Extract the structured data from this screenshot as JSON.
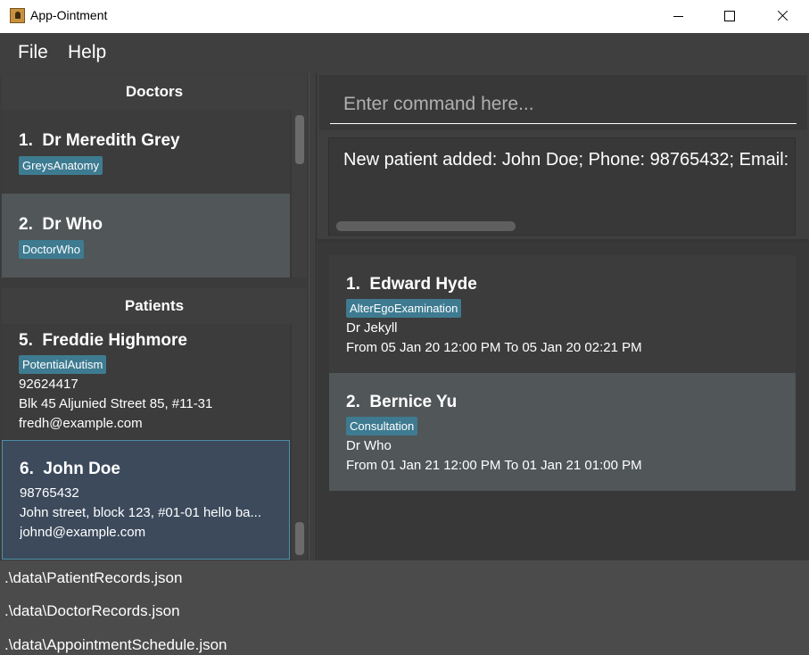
{
  "window": {
    "title": "App-Ointment"
  },
  "menu": {
    "file": "File",
    "help": "Help"
  },
  "doctors": {
    "header": "Doctors",
    "items": [
      {
        "index": "1.",
        "name": "Dr Meredith Grey",
        "tag": "GreysAnatomy"
      },
      {
        "index": "2.",
        "name": "Dr Who",
        "tag": "DoctorWho"
      }
    ]
  },
  "patients": {
    "header": "Patients",
    "items": [
      {
        "index": "5.",
        "name": "Freddie Highmore",
        "tag": "PotentialAutism",
        "phone": "92624417",
        "address": "Blk 45 Aljunied Street 85, #11-31",
        "email": "fredh@example.com"
      },
      {
        "index": "6.",
        "name": "John Doe",
        "phone": "98765432",
        "address": "John street, block 123, #01-01 hello ba...",
        "email": "johnd@example.com"
      }
    ]
  },
  "command": {
    "placeholder": "Enter command here..."
  },
  "result": {
    "text": "New patient added: John Doe; Phone: 98765432; Email:"
  },
  "appointments": [
    {
      "index": "1.",
      "name": "Edward Hyde",
      "tag": "AlterEgoExamination",
      "doctor": "Dr Jekyll",
      "time": "From 05 Jan 20 12:00 PM To 05 Jan 20 02:21 PM"
    },
    {
      "index": "2.",
      "name": "Bernice Yu",
      "tag": "Consultation",
      "doctor": "Dr Who",
      "time": "From 01 Jan 21 12:00 PM To 01 Jan 21 01:00 PM"
    }
  ],
  "status": {
    "patient_file": ".\\data\\PatientRecords.json",
    "doctor_file": ".\\data\\DoctorRecords.json",
    "appointment_file": ".\\data\\AppointmentSchedule.json"
  },
  "colors": {
    "tag": "#3e7b91",
    "selected_border": "#4c90a8",
    "panel": "#383838"
  }
}
